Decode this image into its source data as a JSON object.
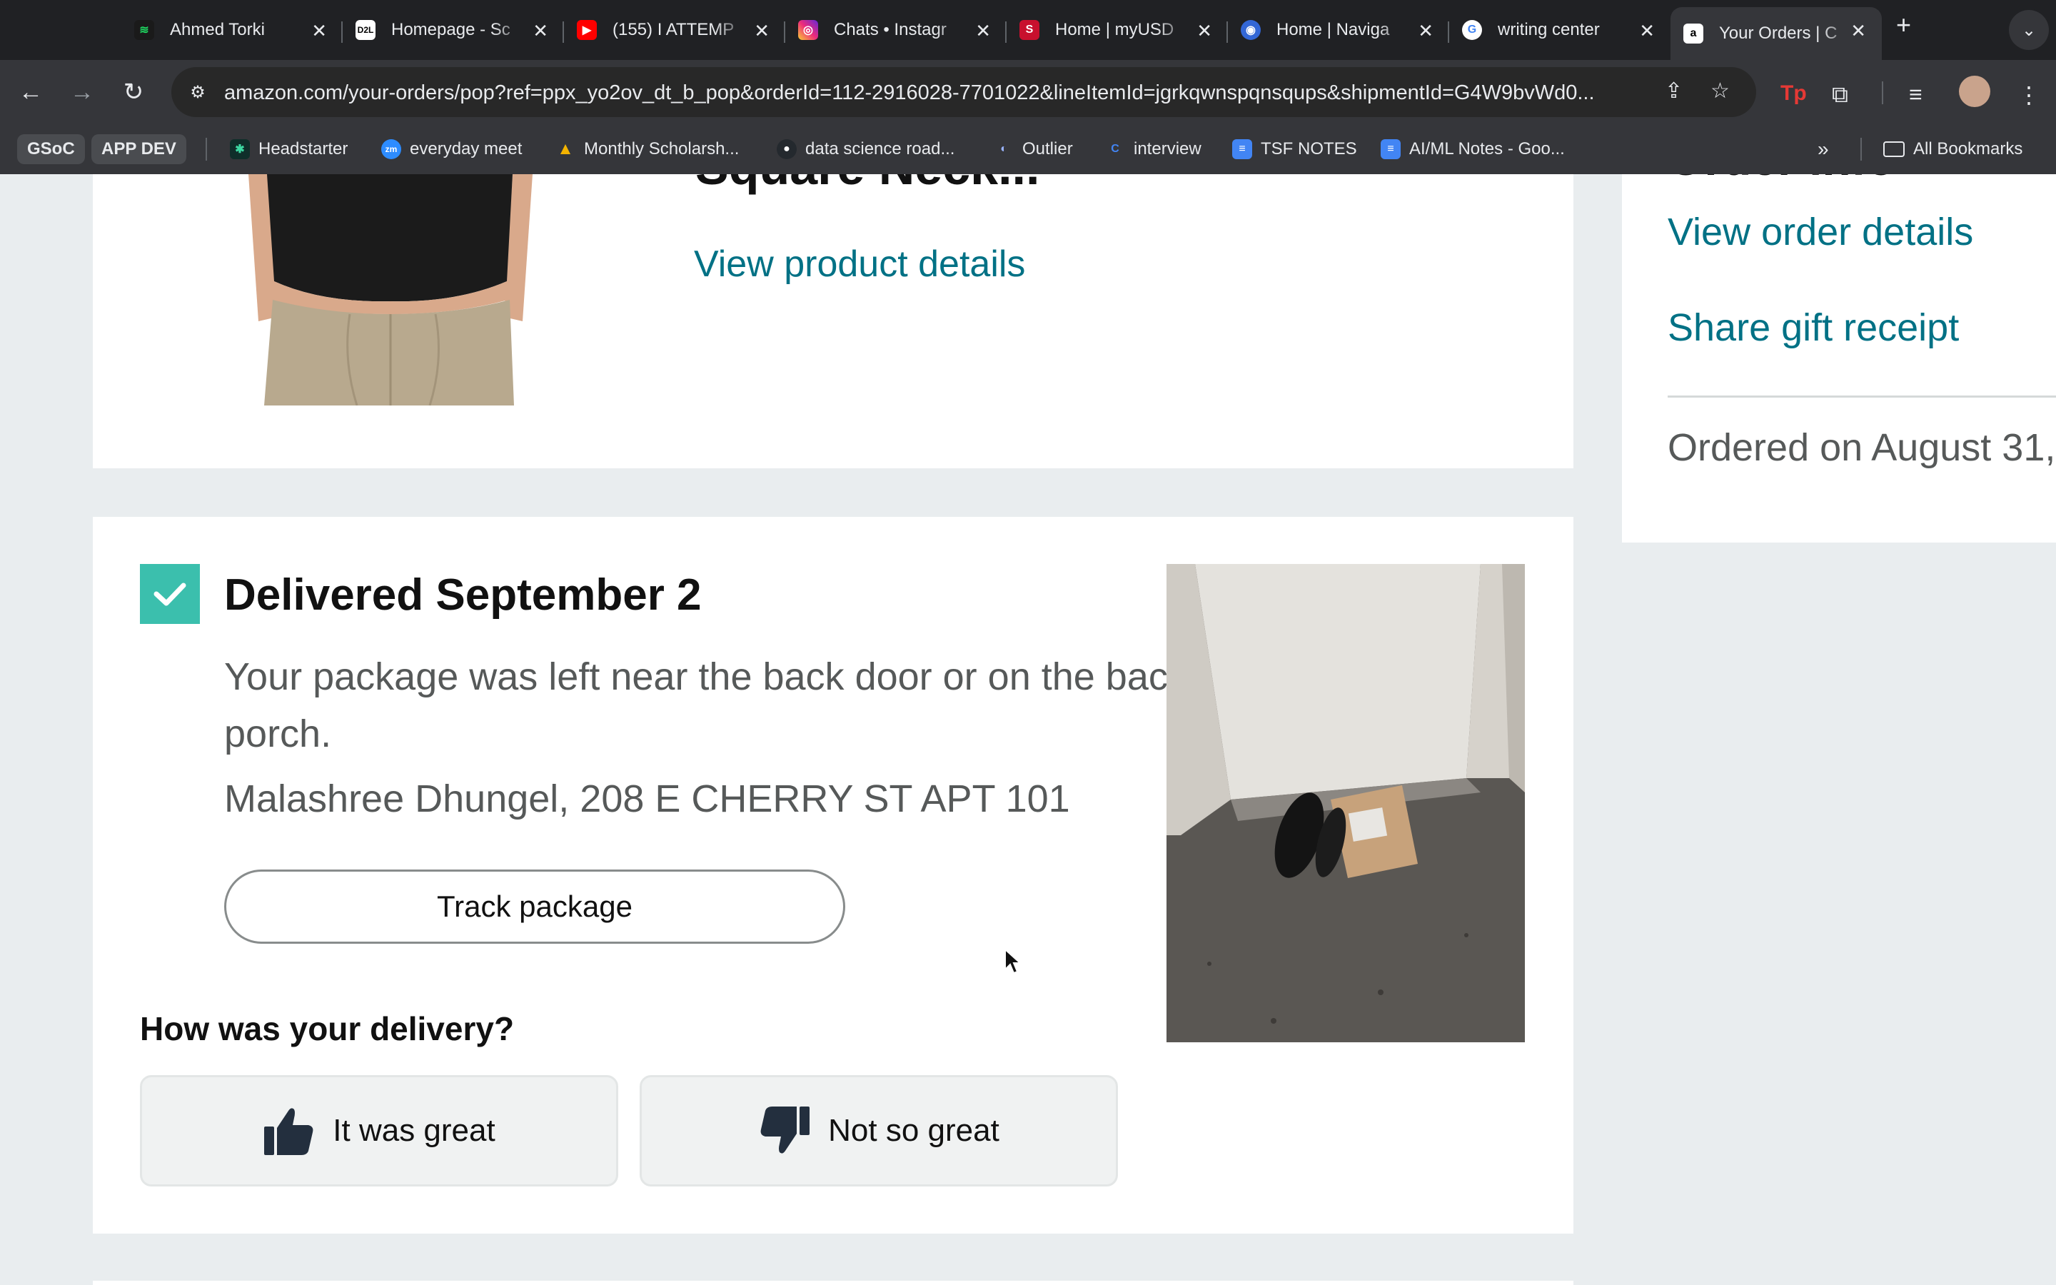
{
  "browser": {
    "tabs": [
      {
        "title": "Ahmed Torki",
        "icon": "spotify-like-icon",
        "color": "#1a1a1a"
      },
      {
        "title": "Homepage - Sc",
        "icon": "d2l-icon",
        "color": "#1a1a1a"
      },
      {
        "title": "(155) I ATTEMP",
        "icon": "youtube-icon",
        "color": "#ff0000"
      },
      {
        "title": "Chats • Instagr",
        "icon": "instagram-icon",
        "color": "#d62976"
      },
      {
        "title": "Home | myUSD",
        "icon": "usd-icon",
        "color": "#c8102e"
      },
      {
        "title": "Home | Naviga",
        "icon": "navigate-icon",
        "color": "#3367d6"
      },
      {
        "title": "writing center",
        "icon": "google-icon",
        "color": "#ffffff"
      },
      {
        "title": "Your Orders | C",
        "icon": "amazon-icon",
        "color": "#ffffff"
      }
    ],
    "url": "amazon.com/your-orders/pop?ref=ppx_yo2ov_dt_b_pop&orderId=112-2916028-7701022&lineItemId=jgrkqwnspqnsqups&shipmentId=G4W9bvWd0...",
    "bookmarks": {
      "chips": [
        "GSoC",
        "APP DEV"
      ],
      "items": [
        {
          "label": "Headstarter",
          "icon": "headstarter-icon"
        },
        {
          "label": "everyday meet",
          "icon": "zoom-icon"
        },
        {
          "label": "Monthly Scholarsh...",
          "icon": "scholarship-icon"
        },
        {
          "label": "data science road...",
          "icon": "github-icon"
        },
        {
          "label": "Outlier",
          "icon": "outlier-icon"
        },
        {
          "label": "interview",
          "icon": "interview-icon"
        },
        {
          "label": "TSF NOTES",
          "icon": "docs-icon"
        },
        {
          "label": "AI/ML Notes - Goo...",
          "icon": "docs-icon"
        }
      ],
      "all_bookmarks": "All Bookmarks"
    }
  },
  "product": {
    "title_fragment": "Square Neck...",
    "view_details": "View product details"
  },
  "order_info": {
    "heading": "Order info",
    "view_order_details": "View order details",
    "share_gift_receipt": "Share gift receipt",
    "ordered_on": "Ordered on August 31,"
  },
  "delivery": {
    "status": "Delivered September 2",
    "note": "Your package was left near the back door or on the back porch.",
    "address": "Malashree Dhungel, 208 E CHERRY ST APT 101",
    "track_label": "Track package",
    "feedback_question": "How was your delivery?",
    "great_label": "It was great",
    "not_great_label": "Not so great"
  },
  "colors": {
    "link": "#007185",
    "check_bg": "#3bbfad",
    "page_bg": "#e9edef"
  }
}
